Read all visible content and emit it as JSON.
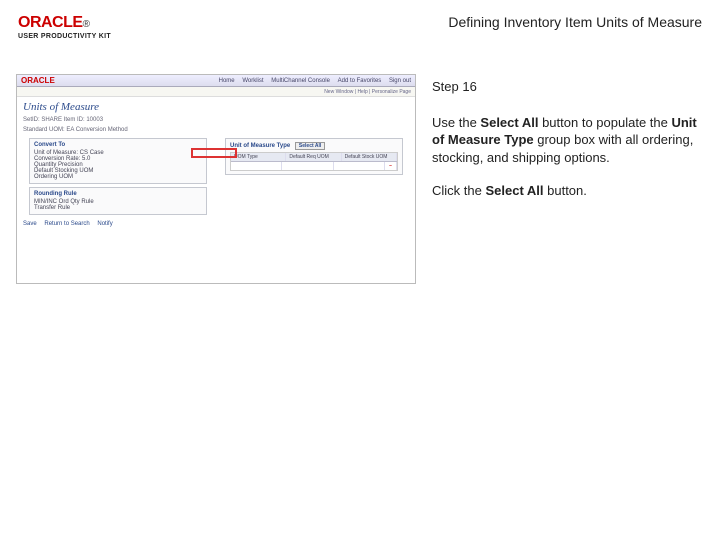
{
  "header": {
    "logo_text": "ORACLE",
    "logo_tm": "®",
    "logo_sub": "USER PRODUCTIVITY KIT",
    "title": "Defining Inventory Item Units of Measure"
  },
  "step": {
    "label": "Step 16",
    "instruction_prefix": "Use the ",
    "instruction_bold1": "Select All",
    "instruction_mid1": " button to populate the ",
    "instruction_bold2": "Unit of Measure Type",
    "instruction_mid2": " group box with all ordering, stocking, and shipping options.",
    "action_prefix": "Click the ",
    "action_bold": "Select All",
    "action_suffix": " button."
  },
  "thumb": {
    "app": "ORACLE",
    "tabs": [
      "Home",
      "Worklist",
      "MultiChannel Console",
      "Add to Favorites",
      "Sign out"
    ],
    "crumb": "New Window | Help | Personalize Page",
    "page_title": "Units of Measure",
    "setid_row": "SetID: SHARE    Item ID: 10003",
    "std_row": "Standard UOM: EA    Conversion Method",
    "box1_hd": "Convert To",
    "b1_l1": "Unit of Measure: CS  Case",
    "b1_l2": "Conversion Rate: 5.0",
    "b1_l3": "Quantity Precision",
    "b1_l4": "Default Stocking UOM",
    "b1_l5": "Ordering UOM",
    "box2_hd": "Unit of Measure Type",
    "select_all": "Select All",
    "grid_hd": [
      "UOM Type",
      "Default Req UOM",
      "Default Stock UOM",
      ""
    ],
    "grid_row": [
      "",
      "",
      "",
      "–"
    ],
    "box3_hd": "Rounding Rule",
    "b3_l1": "MIN/INC Ord Qty Rule",
    "b3_l2": "Transfer Rule",
    "footers": [
      "Save",
      "Return to Search",
      "Notify"
    ]
  }
}
